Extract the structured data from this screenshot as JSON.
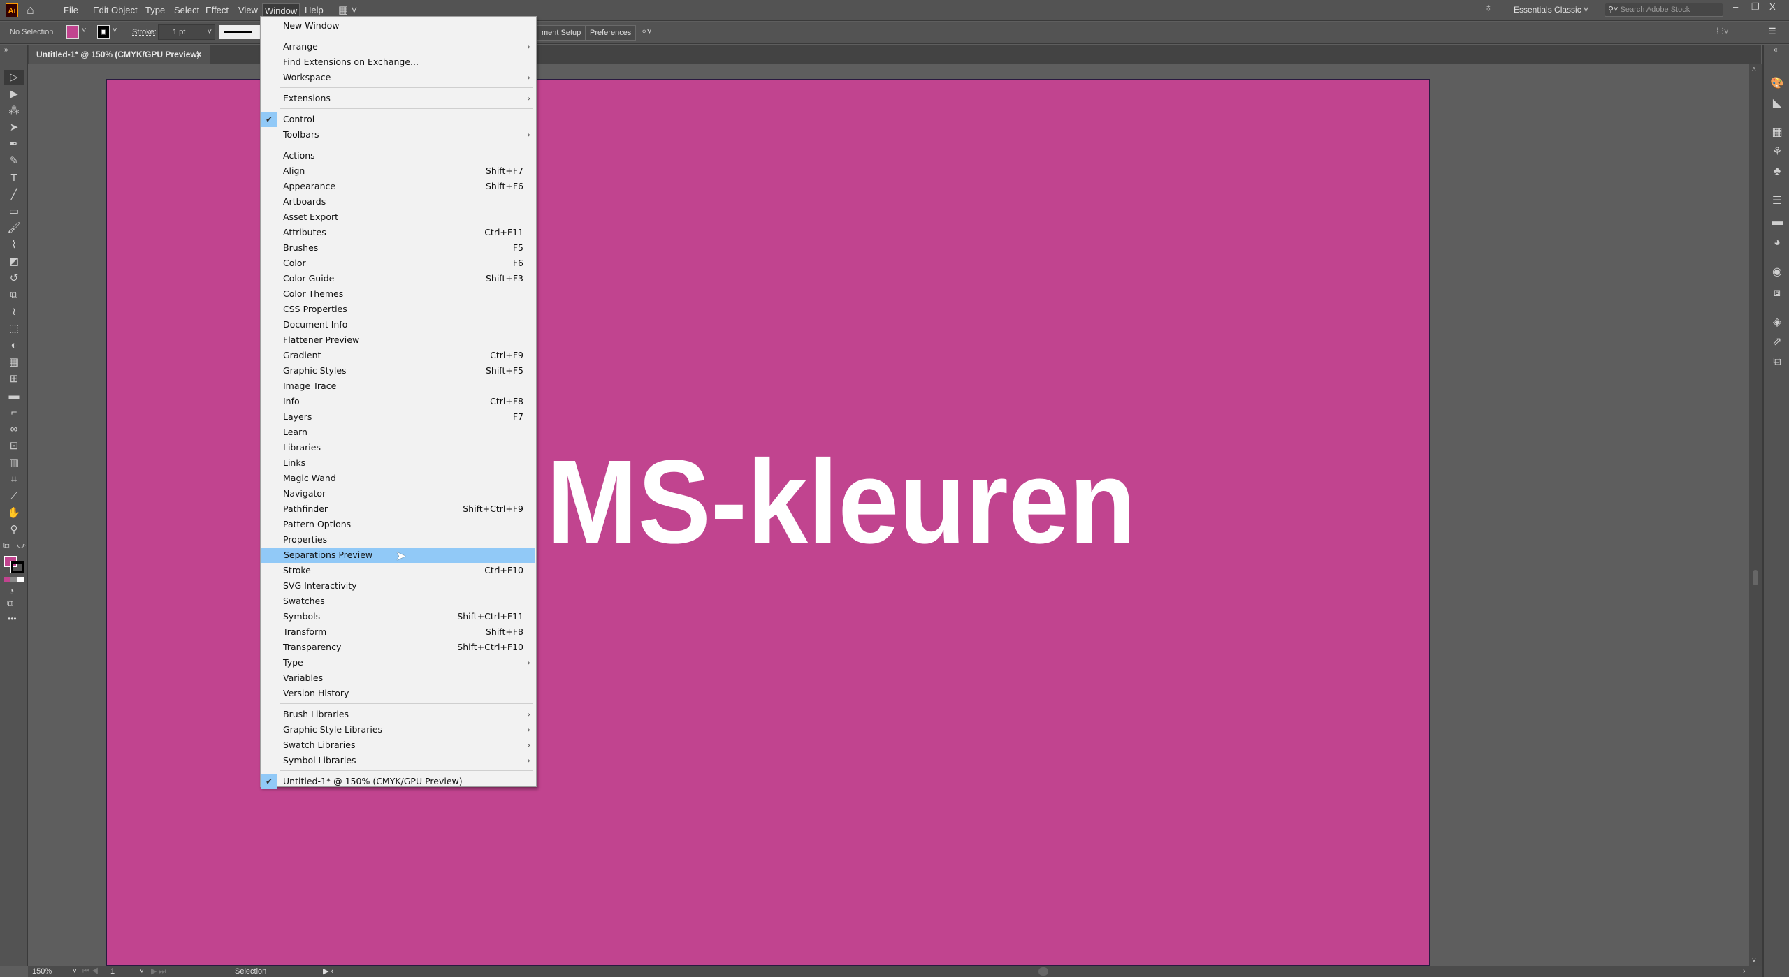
{
  "app": {
    "logo": "Ai",
    "home_icon": "home-icon"
  },
  "menubar": {
    "items": [
      "File",
      "Edit",
      "Object",
      "Type",
      "Select",
      "Effect",
      "View",
      "Window",
      "Help"
    ],
    "active": "Window"
  },
  "header_right": {
    "workspace": "Essentials Classic",
    "search_placeholder": "Search Adobe Stock"
  },
  "control": {
    "selection": "No Selection",
    "stroke_label": "Stroke:",
    "stroke_value": "1 pt",
    "document_setup": "ment Setup",
    "preferences": "Preferences",
    "fill_color": "#c1448f"
  },
  "tab": {
    "title": "Untitled-1* @ 150% (CMYK/GPU Preview)",
    "close": "×"
  },
  "canvas": {
    "text": "MS-kleuren",
    "artboard_color": "#c1448f"
  },
  "status": {
    "zoom": "150%",
    "artboard": "1",
    "tool": "Selection"
  },
  "menu": {
    "items": [
      {
        "label": "New Window"
      },
      {
        "sep": true
      },
      {
        "label": "Arrange",
        "sub": true
      },
      {
        "label": "Find Extensions on Exchange..."
      },
      {
        "label": "Workspace",
        "sub": true
      },
      {
        "sep": true
      },
      {
        "label": "Extensions",
        "sub": true
      },
      {
        "sep": true
      },
      {
        "label": "Control",
        "checked": true
      },
      {
        "label": "Toolbars",
        "sub": true
      },
      {
        "sep": true
      },
      {
        "label": "Actions"
      },
      {
        "label": "Align",
        "shortcut": "Shift+F7"
      },
      {
        "label": "Appearance",
        "shortcut": "Shift+F6"
      },
      {
        "label": "Artboards"
      },
      {
        "label": "Asset Export"
      },
      {
        "label": "Attributes",
        "shortcut": "Ctrl+F11"
      },
      {
        "label": "Brushes",
        "shortcut": "F5"
      },
      {
        "label": "Color",
        "shortcut": "F6"
      },
      {
        "label": "Color Guide",
        "shortcut": "Shift+F3"
      },
      {
        "label": "Color Themes"
      },
      {
        "label": "CSS Properties"
      },
      {
        "label": "Document Info"
      },
      {
        "label": "Flattener Preview"
      },
      {
        "label": "Gradient",
        "shortcut": "Ctrl+F9"
      },
      {
        "label": "Graphic Styles",
        "shortcut": "Shift+F5"
      },
      {
        "label": "Image Trace"
      },
      {
        "label": "Info",
        "shortcut": "Ctrl+F8"
      },
      {
        "label": "Layers",
        "shortcut": "F7"
      },
      {
        "label": "Learn"
      },
      {
        "label": "Libraries"
      },
      {
        "label": "Links"
      },
      {
        "label": "Magic Wand"
      },
      {
        "label": "Navigator"
      },
      {
        "label": "Pathfinder",
        "shortcut": "Shift+Ctrl+F9"
      },
      {
        "label": "Pattern Options"
      },
      {
        "label": "Properties"
      },
      {
        "label": "Separations Preview",
        "highlighted": true
      },
      {
        "label": "Stroke",
        "shortcut": "Ctrl+F10"
      },
      {
        "label": "SVG Interactivity"
      },
      {
        "label": "Swatches"
      },
      {
        "label": "Symbols",
        "shortcut": "Shift+Ctrl+F11"
      },
      {
        "label": "Transform",
        "shortcut": "Shift+F8"
      },
      {
        "label": "Transparency",
        "shortcut": "Shift+Ctrl+F10"
      },
      {
        "label": "Type",
        "sub": true
      },
      {
        "label": "Variables"
      },
      {
        "label": "Version History"
      },
      {
        "sep": true
      },
      {
        "label": "Brush Libraries",
        "sub": true
      },
      {
        "label": "Graphic Style Libraries",
        "sub": true
      },
      {
        "label": "Swatch Libraries",
        "sub": true
      },
      {
        "label": "Symbol Libraries",
        "sub": true
      },
      {
        "sep": true
      },
      {
        "label": "Untitled-1* @ 150% (CMYK/GPU Preview)",
        "checked": true
      }
    ]
  },
  "tools": [
    {
      "name": "selection-tool-icon",
      "glyph": "▷"
    },
    {
      "name": "direct-selection-tool-icon",
      "glyph": "▶"
    },
    {
      "name": "magic-wand-tool-icon",
      "glyph": "⁂"
    },
    {
      "name": "lasso-tool-icon",
      "glyph": "➤"
    },
    {
      "name": "pen-tool-icon",
      "glyph": "✒"
    },
    {
      "name": "curvature-tool-icon",
      "glyph": "✎"
    },
    {
      "name": "type-tool-icon",
      "glyph": "T"
    },
    {
      "name": "line-tool-icon",
      "glyph": "╱"
    },
    {
      "name": "rectangle-tool-icon",
      "glyph": "▭"
    },
    {
      "name": "paintbrush-tool-icon",
      "glyph": "🖌"
    },
    {
      "name": "blob-brush-tool-icon",
      "glyph": "⌇"
    },
    {
      "name": "eraser-tool-icon",
      "glyph": "◩"
    },
    {
      "name": "rotate-tool-icon",
      "glyph": "↺"
    },
    {
      "name": "scale-tool-icon",
      "glyph": "⧉"
    },
    {
      "name": "warp-tool-icon",
      "glyph": "≀"
    },
    {
      "name": "free-transform-tool-icon",
      "glyph": "⬚"
    },
    {
      "name": "shape-builder-tool-icon",
      "glyph": "◐"
    },
    {
      "name": "perspective-grid-tool-icon",
      "glyph": "▦"
    },
    {
      "name": "mesh-tool-icon",
      "glyph": "⊞"
    },
    {
      "name": "gradient-tool-icon",
      "glyph": "▬"
    },
    {
      "name": "eyedropper-tool-icon",
      "glyph": "⌐"
    },
    {
      "name": "blend-tool-icon",
      "glyph": "∞"
    },
    {
      "name": "symbol-sprayer-tool-icon",
      "glyph": "⊡"
    },
    {
      "name": "column-graph-tool-icon",
      "glyph": "▥"
    },
    {
      "name": "artboard-tool-icon",
      "glyph": "⌗"
    },
    {
      "name": "slice-tool-icon",
      "glyph": "⟋"
    },
    {
      "name": "hand-tool-icon",
      "glyph": "✋"
    },
    {
      "name": "zoom-tool-icon",
      "glyph": "⚲"
    }
  ],
  "dock": [
    {
      "name": "color-panel-icon",
      "glyph": "🎨"
    },
    {
      "name": "color-guide-panel-icon",
      "glyph": "◣"
    },
    {
      "name": "swatches-panel-icon",
      "glyph": "▦"
    },
    {
      "name": "brushes-panel-icon",
      "glyph": "⚘"
    },
    {
      "name": "symbols-panel-icon",
      "glyph": "♣"
    },
    {
      "name": "stroke-panel-icon",
      "glyph": "☰"
    },
    {
      "name": "gradient-panel-icon",
      "glyph": "▬"
    },
    {
      "name": "transparency-panel-icon",
      "glyph": "◕"
    },
    {
      "name": "appearance-panel-icon",
      "glyph": "◉"
    },
    {
      "name": "graphic-styles-panel-icon",
      "glyph": "⧈"
    },
    {
      "name": "layers-panel-icon",
      "glyph": "◈"
    },
    {
      "name": "asset-export-panel-icon",
      "glyph": "⇗"
    },
    {
      "name": "artboards-panel-icon",
      "glyph": "⧉"
    }
  ]
}
